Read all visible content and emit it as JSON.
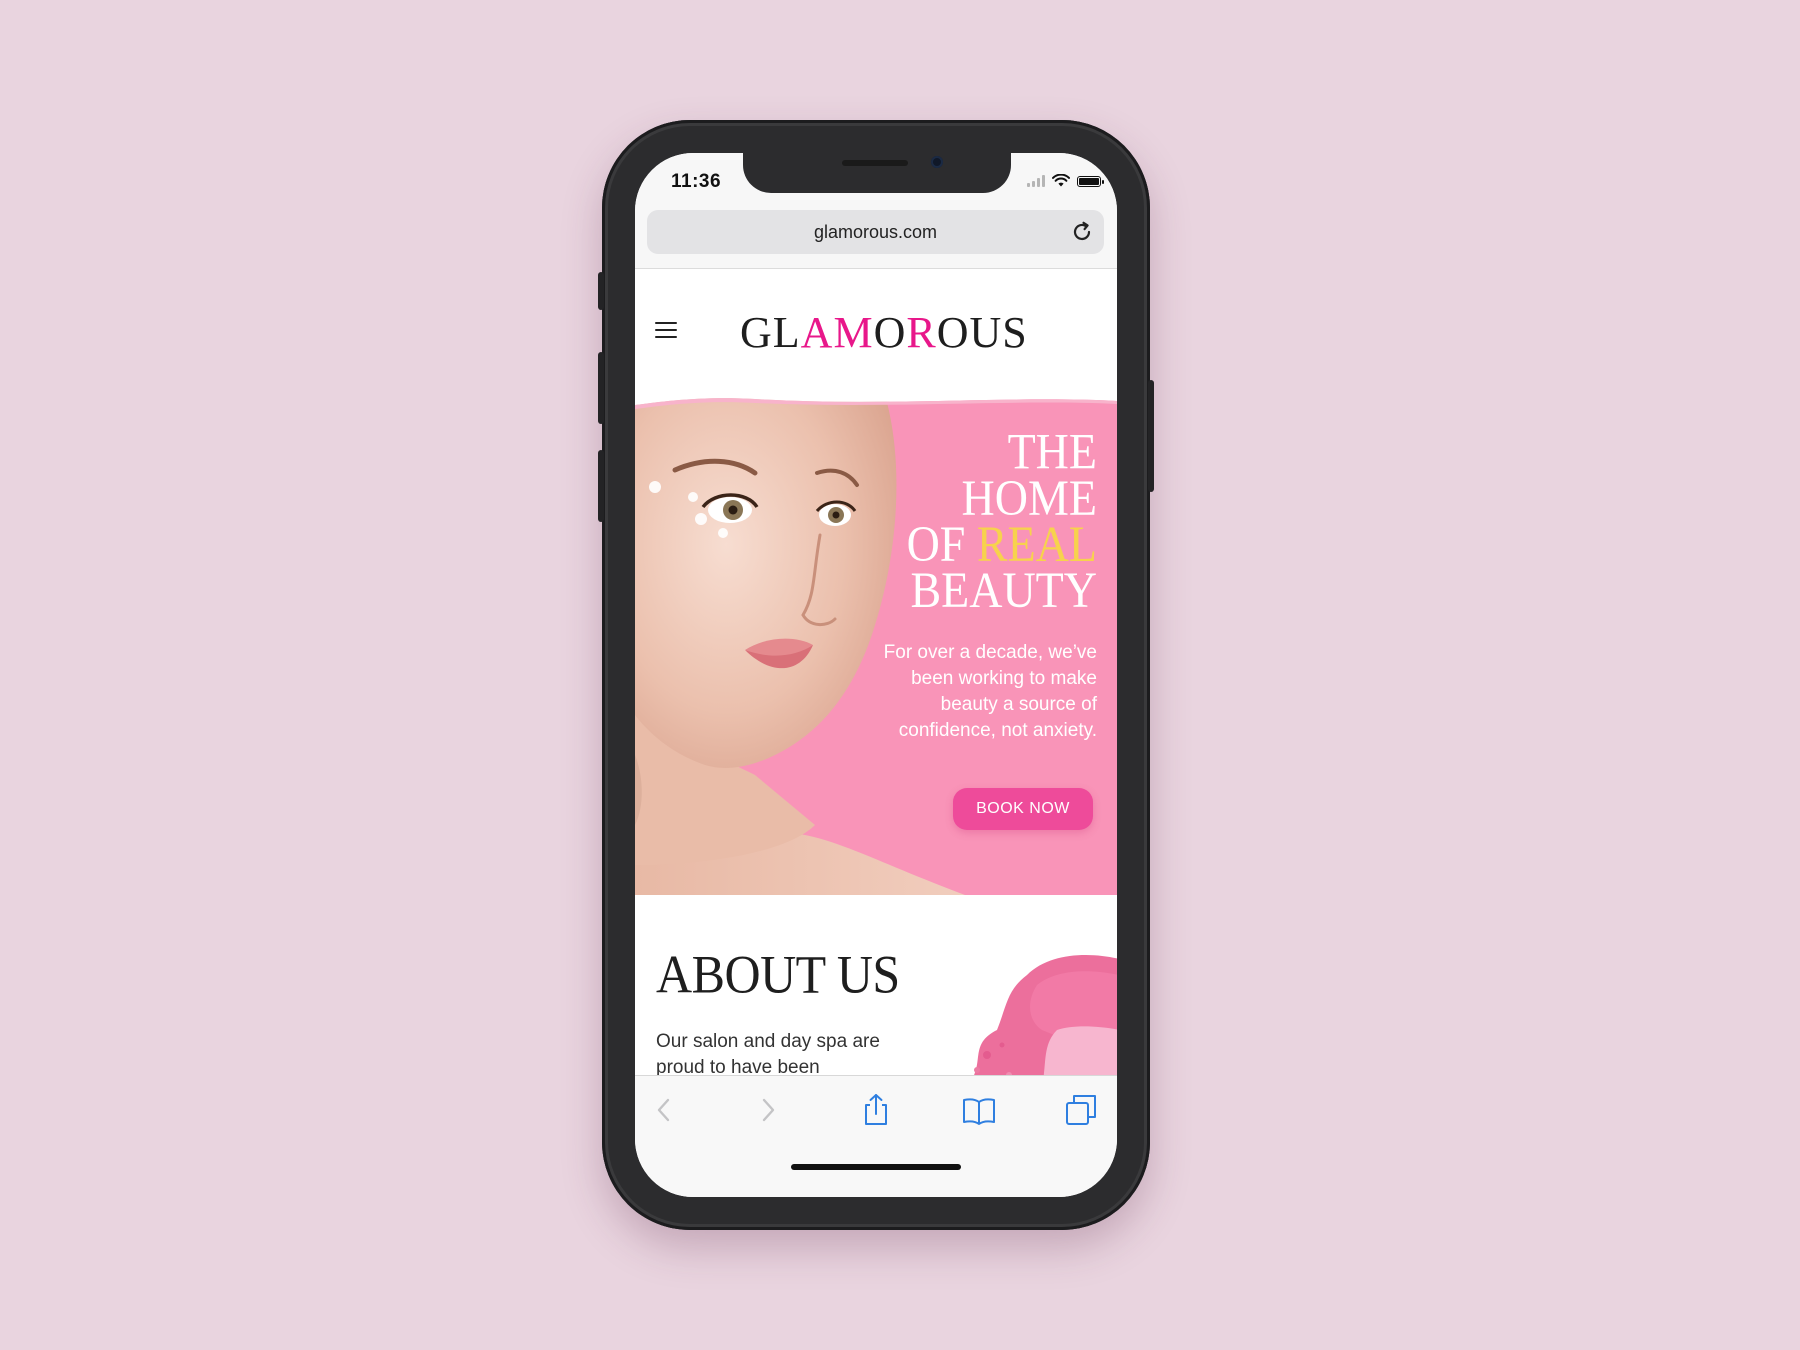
{
  "status_bar": {
    "time": "11:36"
  },
  "browser": {
    "url": "glamorous.com",
    "reload_icon": "reload-icon"
  },
  "site": {
    "logo": {
      "part1": "GL",
      "part2": "A",
      "part3": "M",
      "part4": "O",
      "part5": "R",
      "part6": "OUS"
    },
    "menu_icon": "hamburger-menu-icon"
  },
  "hero": {
    "title_line1": "THE",
    "title_line2": "HOME",
    "title_line3_a": "OF",
    "title_line3_b": "REAL",
    "title_line4": "BEAUTY",
    "description": "For over a decade, we’ve been working to make beauty a source of confidence, not anxiety.",
    "button_label": "BOOK NOW"
  },
  "about": {
    "title": "ABOUT US",
    "text": "Our salon and day spa are proud to have been"
  },
  "toolbar": {
    "back_icon": "chevron-left-icon",
    "forward_icon": "chevron-right-icon",
    "share_icon": "share-icon",
    "bookmarks_icon": "book-icon",
    "tabs_icon": "tabs-icon"
  },
  "colors": {
    "background": "#e9d4df",
    "brand_pink": "#e8178a",
    "hero_pink": "#f994b8",
    "button_pink": "#ee4b9a",
    "accent_gold": "#f7d24d",
    "ios_blue": "#2f7fe0"
  }
}
